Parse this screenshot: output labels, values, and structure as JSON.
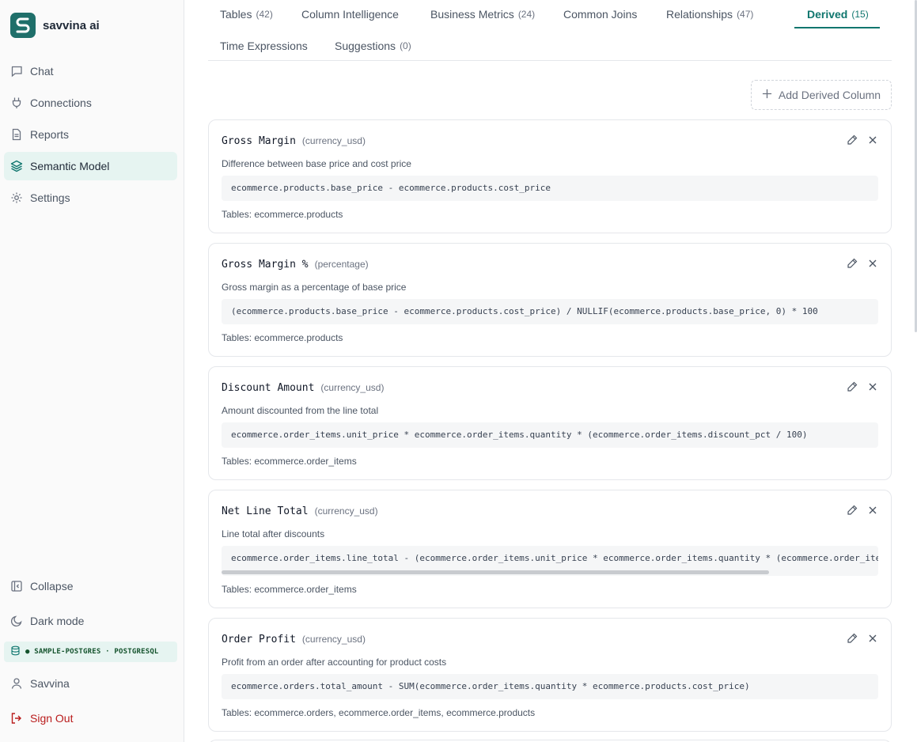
{
  "app": {
    "name": "savvina ai"
  },
  "sidebar": {
    "items": [
      {
        "label": "Chat",
        "icon": "chat-bubble-icon"
      },
      {
        "label": "Connections",
        "icon": "plug-icon"
      },
      {
        "label": "Reports",
        "icon": "document-icon"
      },
      {
        "label": "Semantic Model",
        "icon": "layers-icon",
        "active": true
      },
      {
        "label": "Settings",
        "icon": "gear-icon"
      }
    ],
    "collapse_label": "Collapse",
    "dark_mode_label": "Dark mode",
    "connection_label": "● SAMPLE-POSTGRES · POSTGRESQL",
    "user_label": "Savvina",
    "signout_label": "Sign Out"
  },
  "tabs": [
    {
      "label": "Tables",
      "count": "(42)"
    },
    {
      "label": "Column Intelligence",
      "count": ""
    },
    {
      "label": "Business Metrics",
      "count": "(24)"
    },
    {
      "label": "Common Joins",
      "count": ""
    },
    {
      "label": "Relationships",
      "count": "(47)"
    },
    {
      "label": "Derived",
      "count": "(15)",
      "active": true
    },
    {
      "label": "Time Expressions",
      "count": ""
    },
    {
      "label": "Suggestions",
      "count": "(0)"
    }
  ],
  "add_button_label": "Add Derived Column",
  "derived_columns": [
    {
      "name": "Gross Margin",
      "type": "(currency_usd)",
      "description": "Difference between base price and cost price",
      "expression": "ecommerce.products.base_price - ecommerce.products.cost_price",
      "tables": "Tables: ecommerce.products"
    },
    {
      "name": "Gross Margin %",
      "type": "(percentage)",
      "description": "Gross margin as a percentage of base price",
      "expression": "(ecommerce.products.base_price - ecommerce.products.cost_price) / NULLIF(ecommerce.products.base_price, 0) * 100",
      "tables": "Tables: ecommerce.products"
    },
    {
      "name": "Discount Amount",
      "type": "(currency_usd)",
      "description": "Amount discounted from the line total",
      "expression": "ecommerce.order_items.unit_price * ecommerce.order_items.quantity * (ecommerce.order_items.discount_pct / 100)",
      "tables": "Tables: ecommerce.order_items"
    },
    {
      "name": "Net Line Total",
      "type": "(currency_usd)",
      "description": "Line total after discounts",
      "expression": "ecommerce.order_items.line_total - (ecommerce.order_items.unit_price * ecommerce.order_items.quantity * (ecommerce.order_ite",
      "tables": "Tables: ecommerce.order_items"
    },
    {
      "name": "Order Profit",
      "type": "(currency_usd)",
      "description": "Profit from an order after accounting for product costs",
      "expression": "ecommerce.orders.total_amount - SUM(ecommerce.order_items.quantity * ecommerce.products.cost_price)",
      "tables": "Tables: ecommerce.orders, ecommerce.order_items, ecommerce.products"
    }
  ],
  "colors": {
    "accent": "#0f766e",
    "active_bg": "#e6f4f1",
    "danger": "#b91c1c"
  }
}
